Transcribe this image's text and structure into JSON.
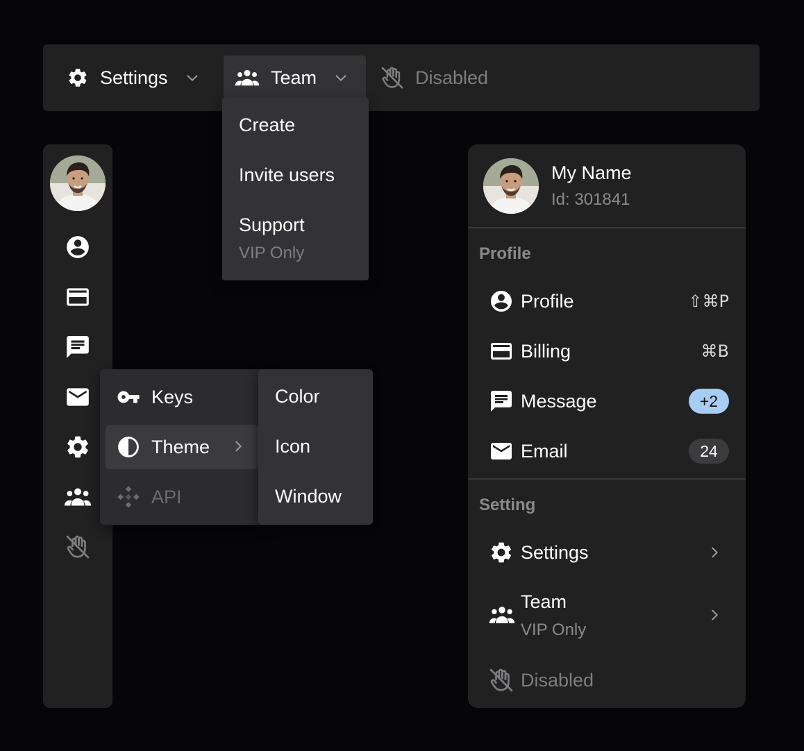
{
  "menubar": {
    "settings_label": "Settings",
    "team_label": "Team",
    "disabled_label": "Disabled"
  },
  "team_menu": {
    "items": [
      {
        "label": "Create"
      },
      {
        "label": "Invite users"
      },
      {
        "label": "Support",
        "sublabel": "VIP Only"
      }
    ]
  },
  "sidebar": {
    "icons": [
      "avatar",
      "profile-icon",
      "billing-icon",
      "message-icon",
      "email-icon",
      "settings-icon",
      "team-icon",
      "disabled-icon"
    ]
  },
  "side_menu": {
    "items": [
      {
        "label": "Keys",
        "icon": "key-icon"
      },
      {
        "label": "Theme",
        "icon": "theme-icon"
      },
      {
        "label": "API",
        "icon": "api-icon"
      }
    ]
  },
  "theme_submenu": {
    "items": [
      {
        "label": "Color"
      },
      {
        "label": "Icon"
      },
      {
        "label": "Window"
      }
    ]
  },
  "panel": {
    "user_name": "My Name",
    "user_id": "Id: 301841",
    "profile_section": "Profile",
    "setting_section": "Setting",
    "rows": {
      "profile": {
        "label": "Profile",
        "shortcut": "⇧⌘P"
      },
      "billing": {
        "label": "Billing",
        "shortcut": "⌘B"
      },
      "message": {
        "label": "Message",
        "badge": "+2"
      },
      "email": {
        "label": "Email",
        "badge": "24"
      },
      "settings": {
        "label": "Settings"
      },
      "team": {
        "label": "Team",
        "sublabel": "VIP Only"
      },
      "disabled": {
        "label": "Disabled"
      }
    }
  },
  "colors": {
    "background": "#060608",
    "surface": "#212122",
    "menu_surface": "#333335",
    "badge_blue": "#a8cdf5",
    "muted_text": "#8a8a8d"
  }
}
